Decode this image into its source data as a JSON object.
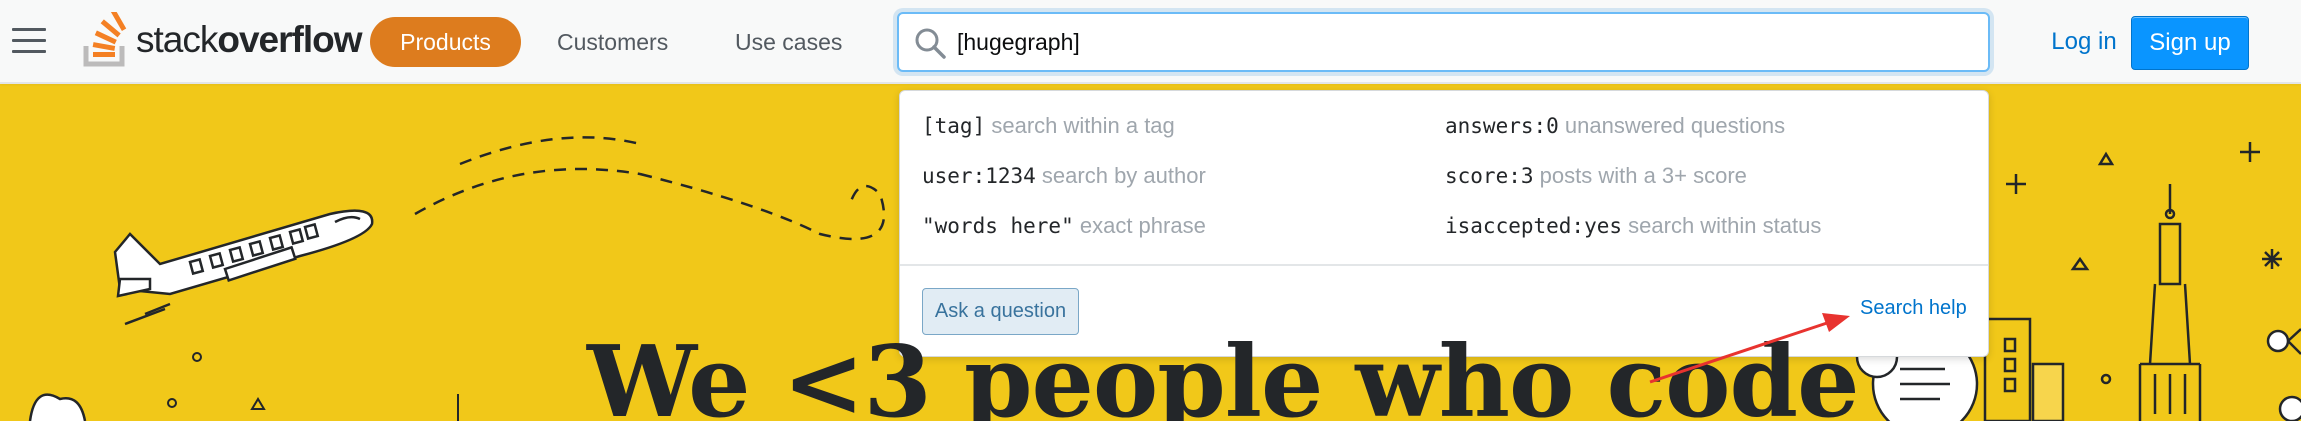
{
  "brand": {
    "name_light": "stack",
    "name_bold": "overflow",
    "colors": {
      "orange": "#dd7c1e",
      "blue": "#0a95ff",
      "yellow": "#f1c819"
    }
  },
  "nav": {
    "products": "Products",
    "customers": "Customers",
    "use_cases": "Use cases",
    "login": "Log in",
    "signup": "Sign up"
  },
  "search": {
    "value": "[hugegraph]"
  },
  "dropdown": {
    "hints_left": [
      {
        "code": "[tag]",
        "text": "search within a tag"
      },
      {
        "code": "user:1234",
        "text": "search by author"
      },
      {
        "code": "\"words here\"",
        "text": "exact phrase"
      }
    ],
    "hints_right": [
      {
        "code": "answers:0",
        "text": "unanswered questions"
      },
      {
        "code": "score:3",
        "text": "posts with a 3+ score"
      },
      {
        "code": "isaccepted:yes",
        "text": "search within status"
      }
    ],
    "ask_button": "Ask a question",
    "search_help": "Search help"
  },
  "hero": {
    "headline": "We <3 people who code"
  },
  "icons": [
    "hamburger-icon",
    "stackoverflow-logo-icon",
    "search-icon"
  ]
}
